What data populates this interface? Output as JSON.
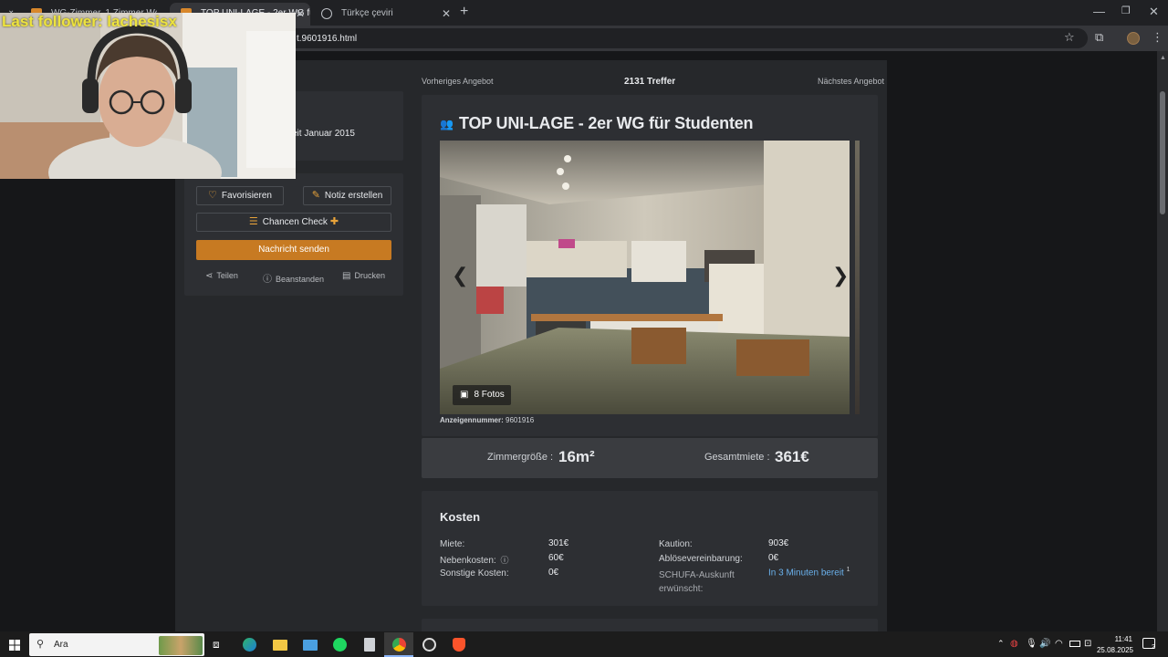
{
  "stream": {
    "follower_text": "Last follower: lachesisx"
  },
  "browser": {
    "tabs": [
      {
        "title": "WG-Zimmer, 1 Zimmer Wohn..."
      },
      {
        "title": "TOP UNI-LAGE - 2er WG für St..."
      },
      {
        "title": "Türkçe çeviri"
      }
    ],
    "url": "t.9601916.html"
  },
  "listing": {
    "nav": {
      "prev": "Vorheriges Angebot",
      "hits": "2131 Treffer",
      "next": "Nächstes Angebot"
    },
    "member_since": "eit Januar 2015",
    "actions": {
      "favorite": "Favorisieren",
      "note": "Notiz erstellen",
      "chance_check": "Chancen Check",
      "send_message": "Nachricht senden",
      "share": "Teilen",
      "report": "Beanstanden",
      "print": "Drucken"
    },
    "title": "TOP UNI-LAGE - 2er WG für Studenten",
    "photos_label": "8 Fotos",
    "ad_number_label": "Anzeigennummer:",
    "ad_number": "9601916",
    "room_size_label": "Zimmergröße :",
    "room_size": "16m²",
    "total_rent_label": "Gesamtmiete :",
    "total_rent": "361€",
    "costs": {
      "heading": "Kosten",
      "rent_label": "Miete:",
      "rent": "301€",
      "side_label": "Nebenkosten:",
      "side": "60€",
      "other_label": "Sonstige Kosten:",
      "other": "0€",
      "deposit_label": "Kaution:",
      "deposit": "903€",
      "transfer_label": "Ablösevereinbarung:",
      "transfer": "0€",
      "schufa_label_1": "SCHUFA-Auskunft",
      "schufa_label_2": "erwünscht:",
      "schufa_link": "In 3 Minuten bereit",
      "schufa_sup": "1"
    }
  },
  "taskbar": {
    "search": "Ara",
    "time": "11:41",
    "date": "25.08.2025",
    "notifications": "2"
  }
}
